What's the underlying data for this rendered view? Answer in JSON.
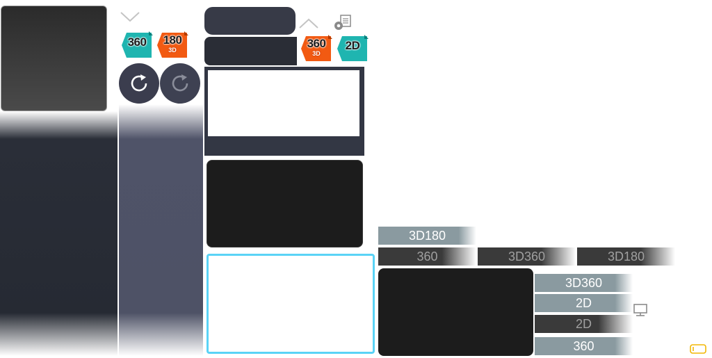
{
  "badges": {
    "a360": {
      "main": "360"
    },
    "a180_3d": {
      "main": "180",
      "sub": "3D"
    },
    "b360_3d": {
      "main": "360",
      "sub": "3D"
    },
    "b2d": {
      "main": "2D"
    }
  },
  "tabs": [
    {
      "label": "3D180",
      "style": "light"
    },
    {
      "label": "360",
      "style": "dark"
    },
    {
      "label": "3D360",
      "style": "dark"
    },
    {
      "label": "3D180",
      "style": "dark"
    },
    {
      "label": "3D360",
      "style": "light"
    },
    {
      "label": "2D",
      "style": "light"
    },
    {
      "label": "2D",
      "style": "dark"
    },
    {
      "label": "360",
      "style": "light"
    }
  ],
  "icons": {
    "chevron_down": "chevron-down-icon",
    "chevron_up": "chevron-up-icon",
    "refresh_active": "refresh-icon",
    "refresh_inactive": "refresh-icon",
    "settings_document": "settings-document-icon",
    "monitor": "monitor-icon",
    "tag": "tag-icon"
  },
  "colors": {
    "teal_badge": "#1fb5b0",
    "orange_badge": "#f25a12",
    "dark_button": "#3b3d4e",
    "highlight_border": "#5ad3f6",
    "light_tab": "#8a9aa0",
    "dark_tab": "#3a3a3a"
  }
}
